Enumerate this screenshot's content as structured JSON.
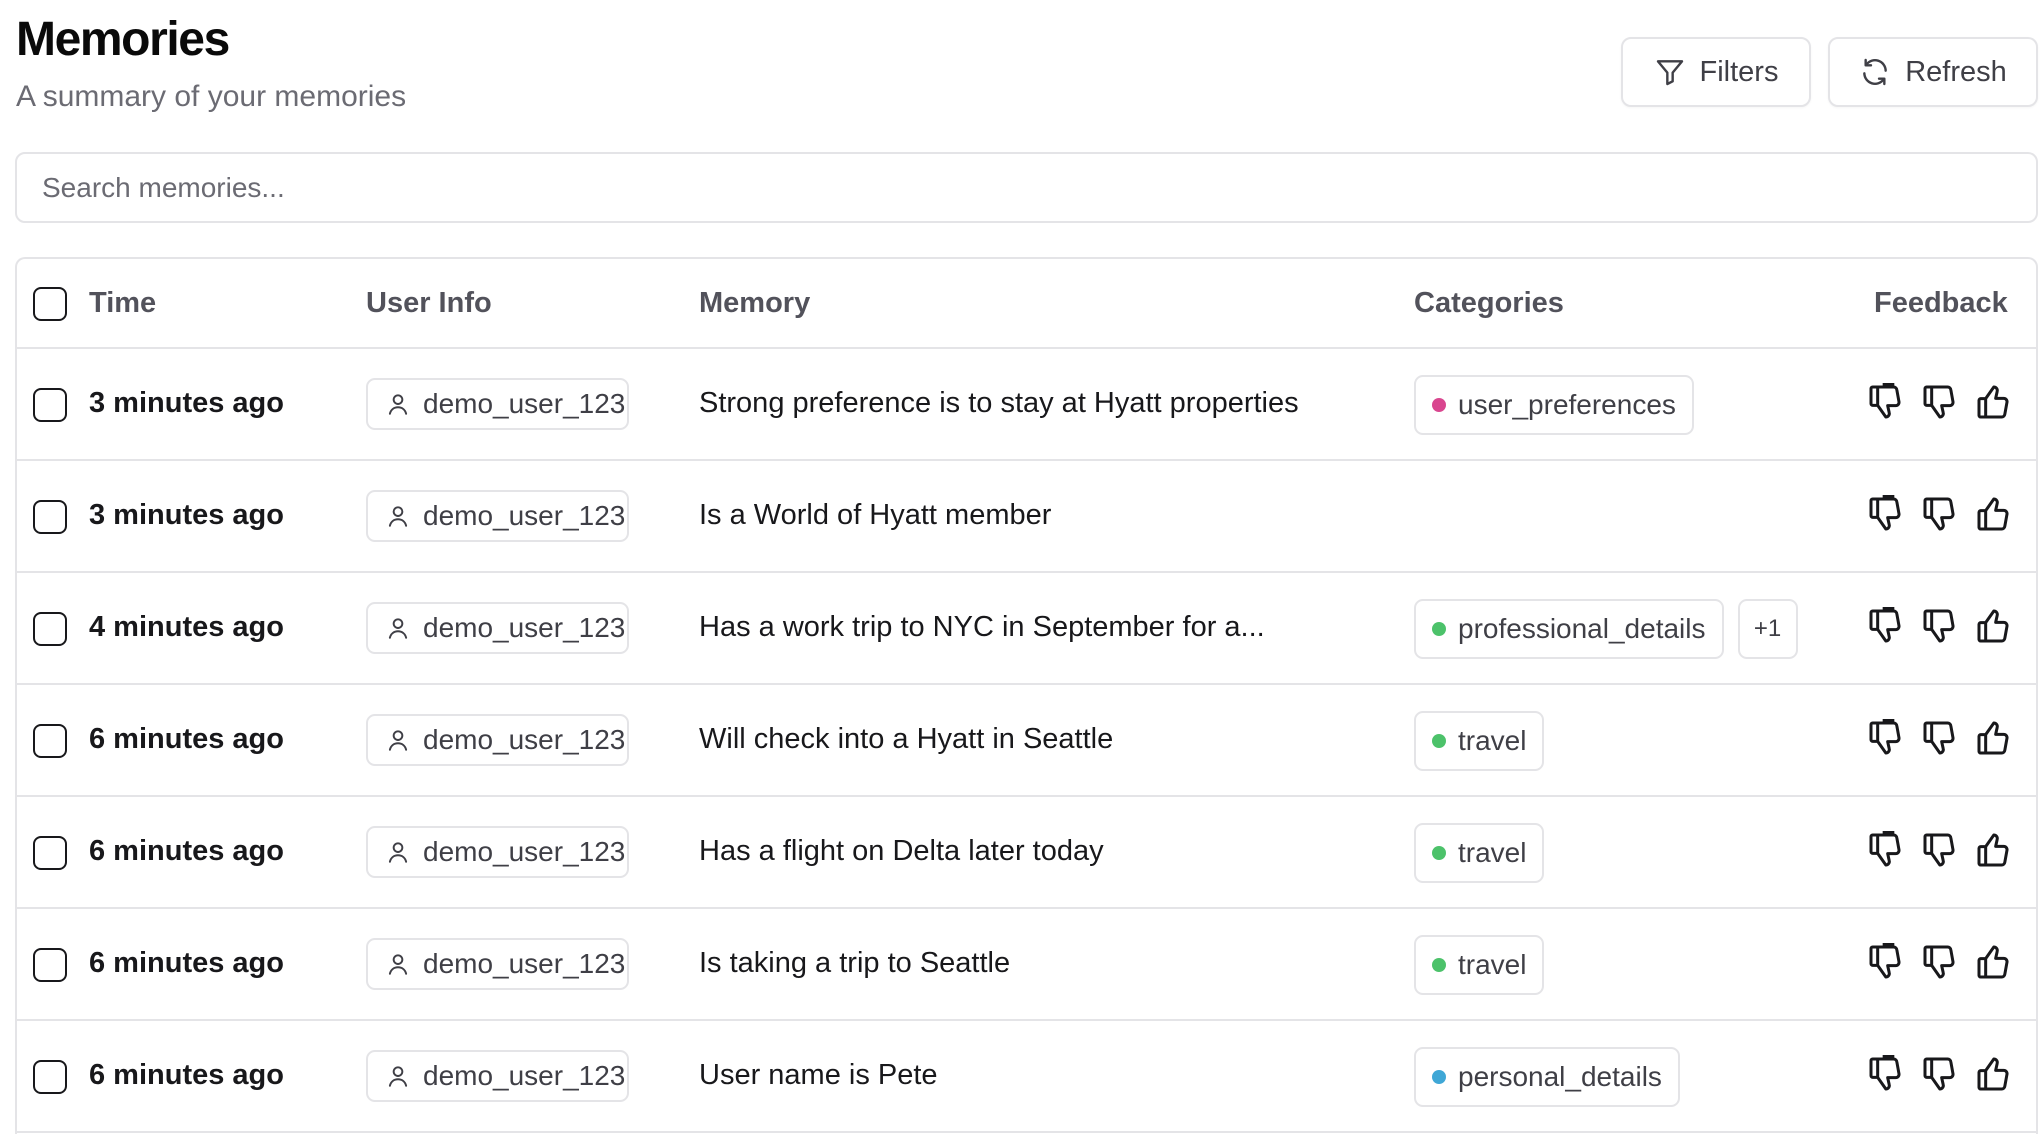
{
  "header": {
    "title": "Memories",
    "subtitle": "A summary of your memories",
    "filters_label": "Filters",
    "refresh_label": "Refresh"
  },
  "search": {
    "placeholder": "Search memories..."
  },
  "table": {
    "columns": [
      "Time",
      "User Info",
      "Memory",
      "Categories",
      "Feedback"
    ],
    "rows": [
      {
        "time": "3 minutes ago",
        "user": "demo_user_123",
        "memory": "Strong preference is to stay at Hyatt properties",
        "categories": [
          {
            "name": "user_preferences",
            "color": "#d9468f"
          }
        ],
        "more": ""
      },
      {
        "time": "3 minutes ago",
        "user": "demo_user_123",
        "memory": "Is a World of Hyatt member",
        "categories": [],
        "more": ""
      },
      {
        "time": "4 minutes ago",
        "user": "demo_user_123",
        "memory": "Has a work trip to NYC in September for a...",
        "categories": [
          {
            "name": "professional_details",
            "color": "#4cc26a"
          }
        ],
        "more": "+1"
      },
      {
        "time": "6 minutes ago",
        "user": "demo_user_123",
        "memory": "Will check into a Hyatt in Seattle",
        "categories": [
          {
            "name": "travel",
            "color": "#4cc26a"
          }
        ],
        "more": ""
      },
      {
        "time": "6 minutes ago",
        "user": "demo_user_123",
        "memory": "Has a flight on Delta later today",
        "categories": [
          {
            "name": "travel",
            "color": "#4cc26a"
          }
        ],
        "more": ""
      },
      {
        "time": "6 minutes ago",
        "user": "demo_user_123",
        "memory": "Is taking a trip to Seattle",
        "categories": [
          {
            "name": "travel",
            "color": "#4cc26a"
          }
        ],
        "more": ""
      },
      {
        "time": "6 minutes ago",
        "user": "demo_user_123",
        "memory": "User name is Pete",
        "categories": [
          {
            "name": "personal_details",
            "color": "#3fa7d6"
          }
        ],
        "more": ""
      }
    ]
  }
}
